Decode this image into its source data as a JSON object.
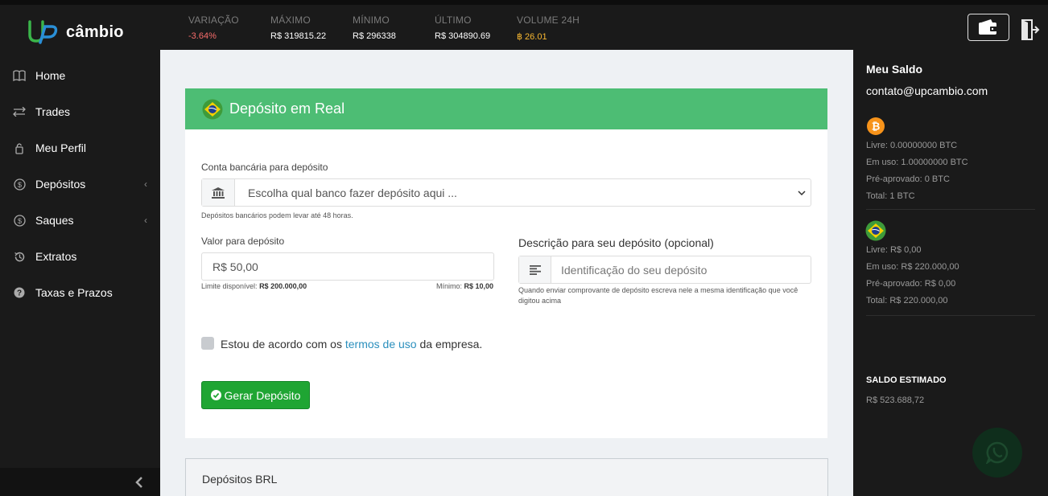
{
  "app": {
    "name": "câmbio"
  },
  "ticker": [
    {
      "label": "VARIAÇÃO",
      "value": "-3.64%",
      "color": "#f86c6b"
    },
    {
      "label": "MÁXIMO",
      "value": "R$ 319815.22",
      "color": "#ffffff"
    },
    {
      "label": "MÍNIMO",
      "value": "R$ 296338",
      "color": "#ffffff"
    },
    {
      "label": "ÚLTIMO",
      "value": "R$ 304890.69",
      "color": "#ffffff"
    },
    {
      "label": "VOLUME 24H",
      "value": "฿ 26.01",
      "color": "#f7b731"
    }
  ],
  "sidebar": {
    "items": [
      {
        "label": "Home",
        "icon": "book-icon"
      },
      {
        "label": "Trades",
        "icon": "arrows-icon"
      },
      {
        "label": "Meu Perfil",
        "icon": "lock-icon"
      },
      {
        "label": "Depósitos",
        "icon": "dollar-circle-icon",
        "chevron": "‹"
      },
      {
        "label": "Saques",
        "icon": "dollar-circle-icon",
        "chevron": "‹"
      },
      {
        "label": "Extratos",
        "icon": "history-icon"
      },
      {
        "label": "Taxas e Prazos",
        "icon": "question-circle-icon"
      }
    ]
  },
  "deposit_form": {
    "title": "Depósito em Real",
    "bank_label": "Conta bancária para depósito",
    "bank_select": "Escolha qual banco fazer depósito aqui ...",
    "bank_help": "Depósitos bancários podem levar até 48 horas.",
    "amount_label": "Valor para depósito",
    "amount_value": "R$ 50,00",
    "limit_label": "Limite disponível:",
    "limit_value": "R$ 200.000,00",
    "min_label": "Mínimo:",
    "min_value": "R$ 10,00",
    "desc_label": "Descrição para seu depósito (opcional)",
    "desc_placeholder": "Identificação do seu depósito",
    "desc_help": "Quando enviar comprovante de depósito escreva nele a mesma identificação que você digitou acima",
    "agree_prefix": "Estou de acordo com os",
    "agree_link": "termos de uso",
    "agree_suffix": "da empresa.",
    "submit": "Gerar Depósito"
  },
  "deposits_list": {
    "title": "Depósitos BRL"
  },
  "balance": {
    "title": "Meu Saldo",
    "email": "contato@upcambio.com",
    "btc": {
      "livre": "Livre: 0.00000000 BTC",
      "em_uso": "Em uso: 1.00000000 BTC",
      "pre_aprovado": "Pré-aprovado: 0 BTC",
      "total": "Total: 1 BTC"
    },
    "brl": {
      "livre": "Livre: R$ 0,00",
      "em_uso": "Em uso: R$ 220.000,00",
      "pre_aprovado": "Pré-aprovado: R$ 0,00",
      "total": "Total: R$ 220.000,00"
    },
    "estimate_label": "SALDO ESTIMADO",
    "estimate_value": "R$ 523.688,72"
  },
  "colors": {
    "accent_green": "#4dbd74",
    "button_green": "#1fa533",
    "negative": "#f86c6b",
    "btc_orange": "#f7931a"
  }
}
